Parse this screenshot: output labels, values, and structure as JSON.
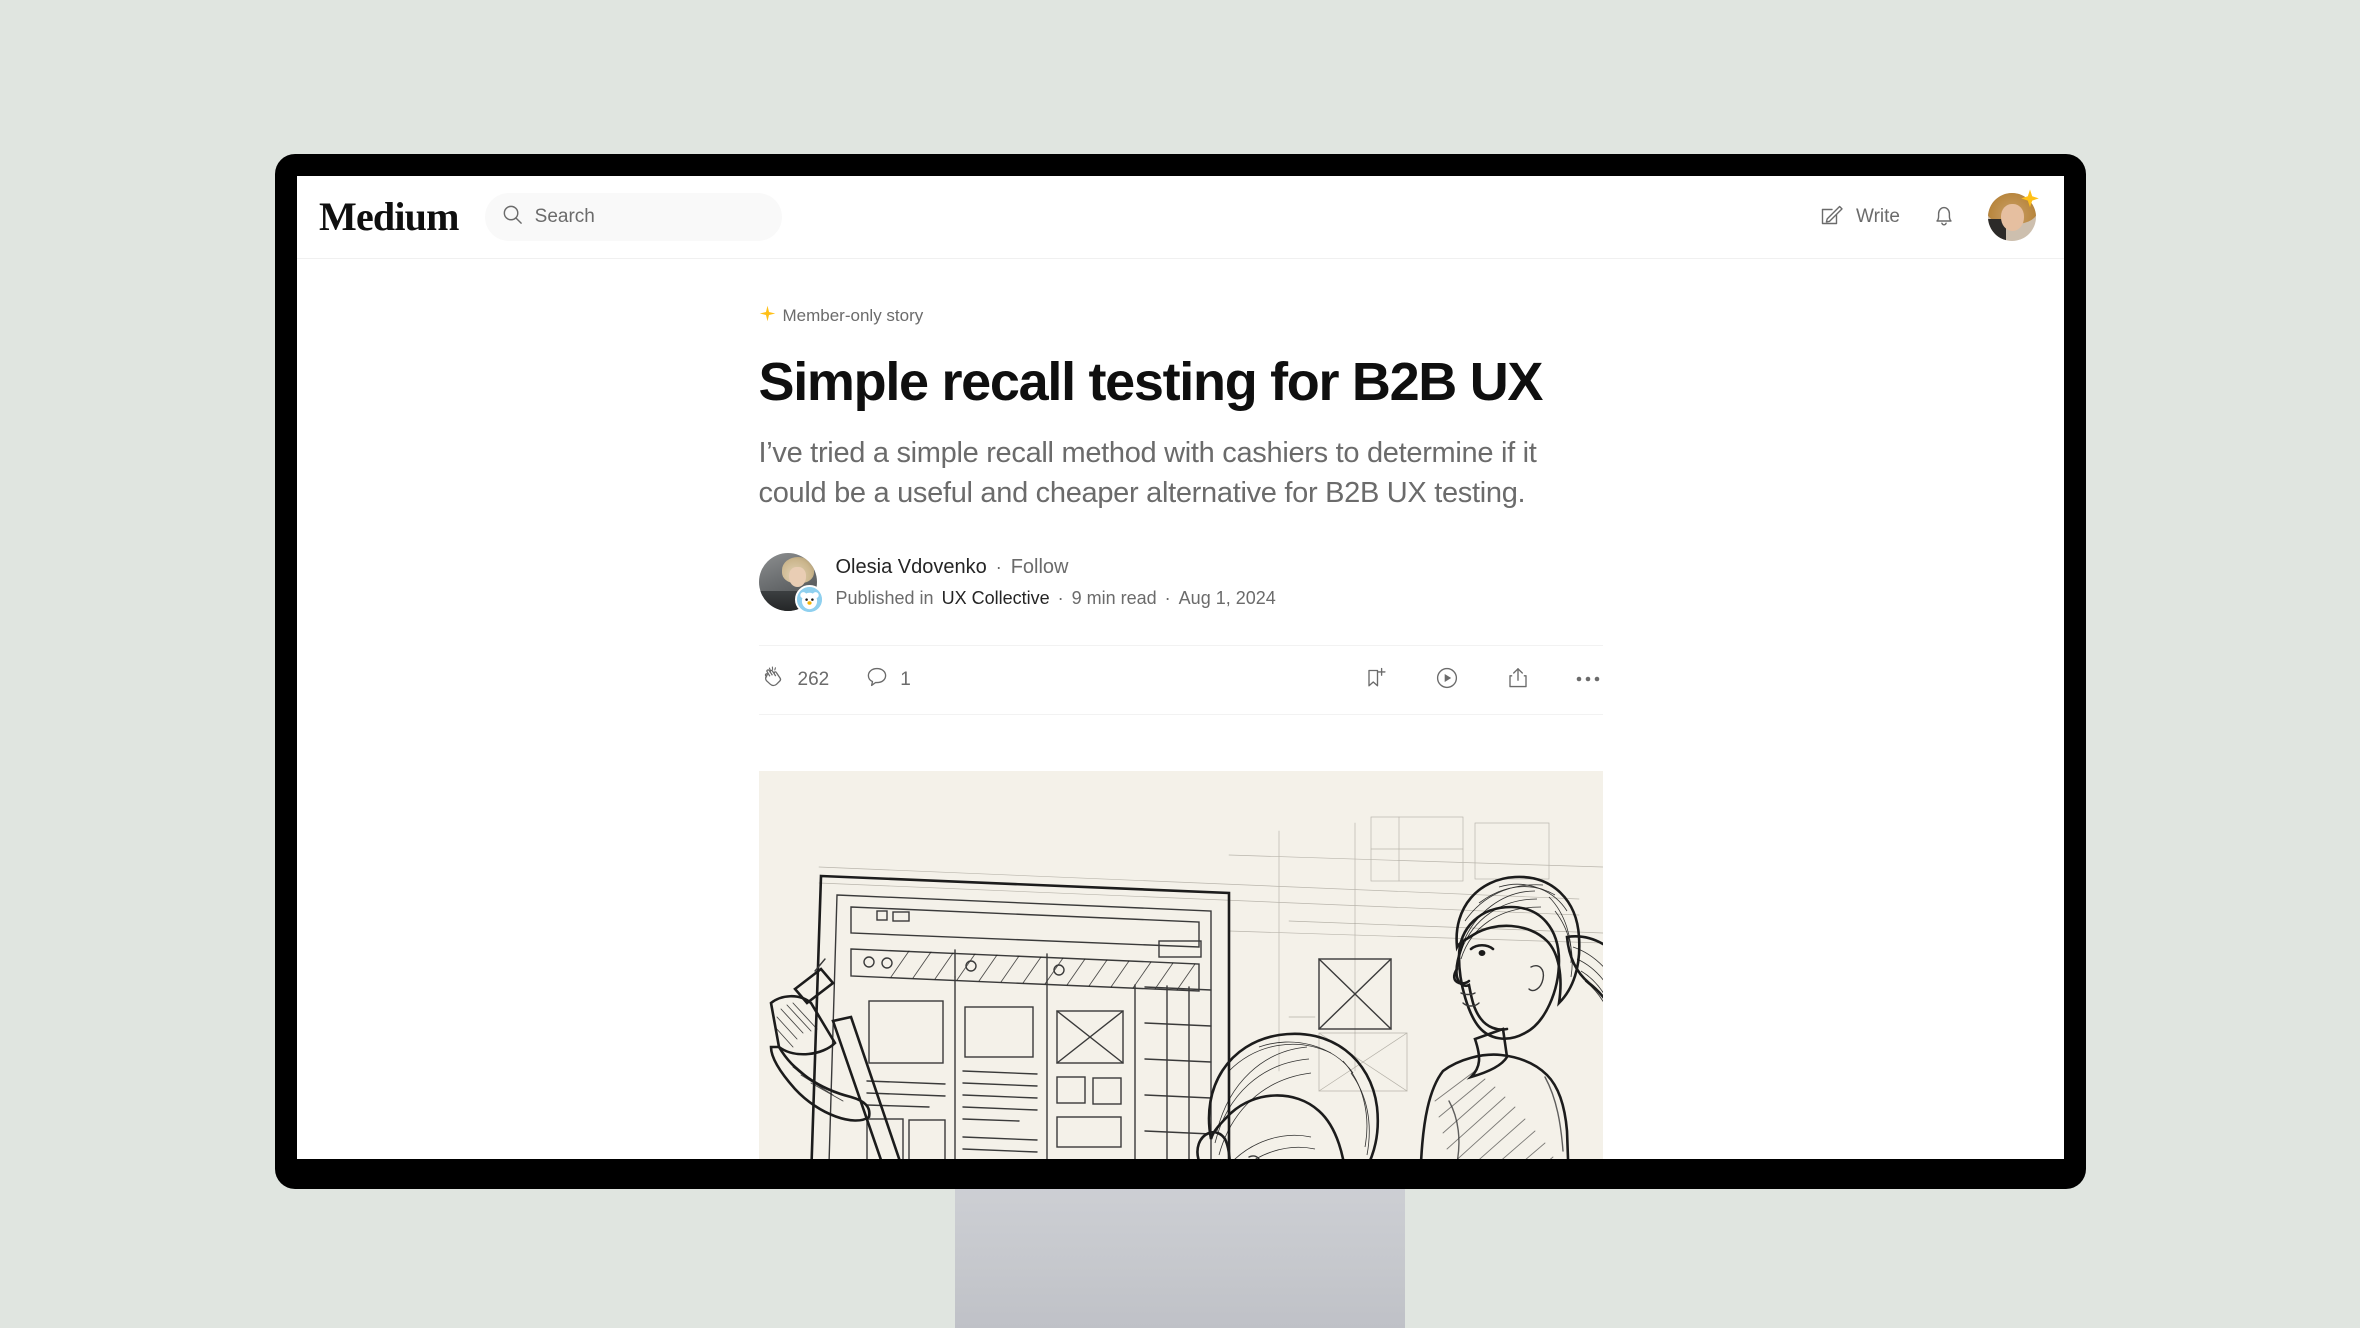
{
  "theme": {
    "page_background": "#e0e5e0",
    "bezel_color": "#000000",
    "stand_color": "#c6c8cd",
    "accent_star": "#ffc017",
    "text_primary": "#242424",
    "text_secondary": "#6b6b6b",
    "hero_paper": "#f4f1e9"
  },
  "header": {
    "brand": "Medium",
    "search": {
      "placeholder": "Search",
      "value": "",
      "icon": "search-icon"
    },
    "write_label": "Write",
    "write_icon": "write-pencil-square-icon",
    "notifications_icon": "bell-icon",
    "avatar": {
      "name": "user-avatar",
      "badge_icon": "star-badge-icon"
    }
  },
  "article": {
    "member_badge": {
      "label": "Member-only story",
      "icon": "sparkle-star-icon"
    },
    "title": "Simple recall testing for B2B UX",
    "subtitle": "I’ve tried a simple recall method with cashiers to determine if it could be a useful and cheaper alternative for B2B UX testing.",
    "byline": {
      "author": "Olesia Vdovenko",
      "separator": "·",
      "follow_label": "Follow",
      "published_in_label": "Published in",
      "publication": "UX Collective",
      "read_time": "9 min read",
      "date": "Aug 1, 2024",
      "author_avatar": "author-avatar",
      "publication_badge": "ux-collective-badge-icon"
    },
    "engagement": {
      "claps_count": "262",
      "claps_icon": "clap-icon",
      "responses_count": "1",
      "responses_icon": "comment-icon",
      "save_icon": "bookmark-add-icon",
      "listen_icon": "play-listen-icon",
      "share_icon": "share-icon",
      "more_icon": "more-options-icon"
    },
    "hero": {
      "name": "hero-illustration",
      "description": "Pencil sketch of two people reviewing wireframes on a large board beside a desk lamp"
    }
  }
}
